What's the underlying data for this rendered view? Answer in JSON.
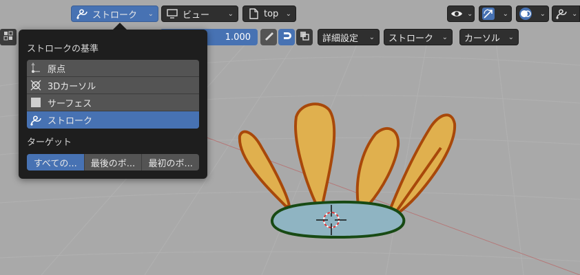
{
  "header": {
    "stroke_button": "ストローク",
    "view_menu": "ビュー",
    "object_menu": "top"
  },
  "toolbar": {
    "strength_value": "1.000",
    "advanced_menu": "詳細設定",
    "stroke_menu": "ストローク",
    "cursor_menu": "カーソル"
  },
  "popover": {
    "title": "ストロークの基準",
    "items": [
      {
        "label": "原点",
        "icon": "origin-icon",
        "active": false
      },
      {
        "label": "3Dカーソル",
        "icon": "cursor-3d-icon",
        "active": false
      },
      {
        "label": "サーフェス",
        "icon": "surface-icon",
        "active": false
      },
      {
        "label": "ストローク",
        "icon": "stroke-icon",
        "active": true
      }
    ],
    "target_title": "ターゲット",
    "targets": [
      {
        "label": "すべての...",
        "active": true
      },
      {
        "label": "最後のボ...",
        "active": false
      },
      {
        "label": "最初のボ...",
        "active": false
      }
    ]
  },
  "colors": {
    "accent": "#4772b3",
    "panel": "#1e1e1e",
    "viewport_bg": "#a9a9a9",
    "petal_fill": "#e0b04e",
    "petal_outline": "#a8480a",
    "base_fill": "#8fb4c2",
    "base_outline": "#184a14"
  }
}
